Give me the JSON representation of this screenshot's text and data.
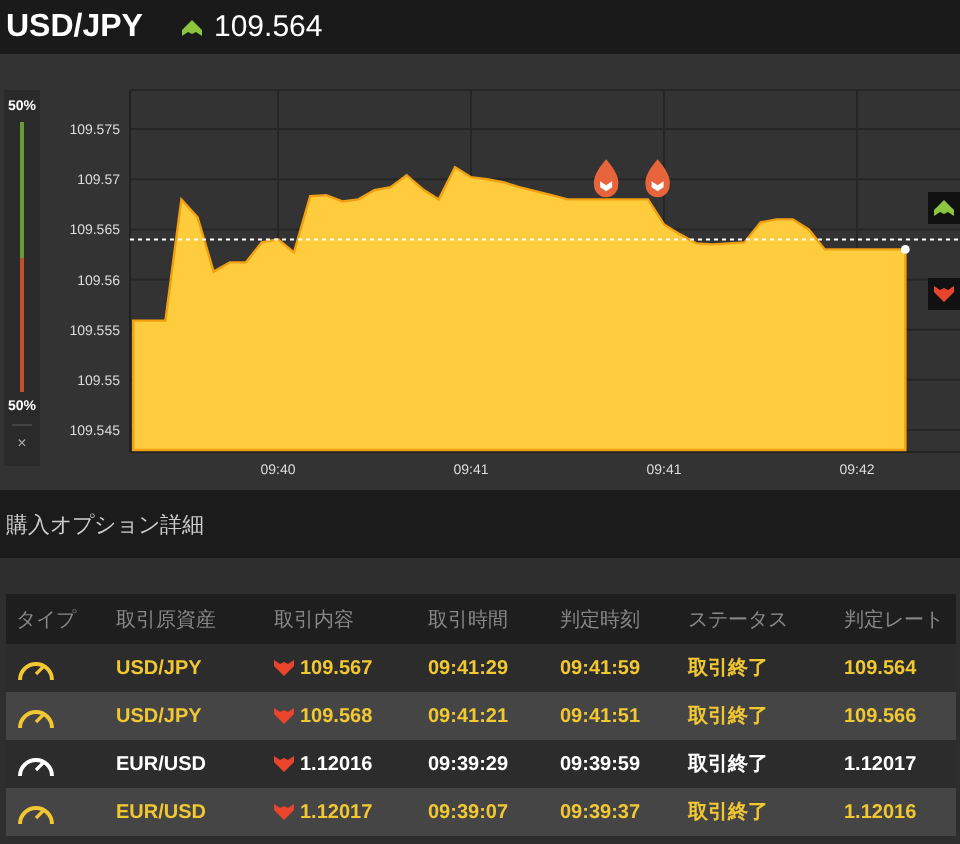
{
  "header": {
    "symbol": "USD/JPY",
    "kind": "up",
    "rate": "109.564"
  },
  "sentiment": {
    "top_label": "50%",
    "bottom_label": "50%",
    "level": 0.5,
    "close": "×"
  },
  "chart": {
    "chart_data": {
      "type": "area",
      "ylim": [
        109.543,
        109.5789
      ],
      "categories": [
        null,
        null,
        null,
        null,
        null,
        null,
        null,
        null,
        null,
        "09:40",
        null,
        null,
        null,
        null,
        null,
        null,
        null,
        null,
        null,
        null,
        null,
        "09:41",
        null,
        null,
        null,
        null,
        null,
        null,
        null,
        null,
        null,
        null,
        null,
        "09:41",
        null,
        null,
        null,
        null,
        null,
        null,
        null,
        null,
        null,
        null,
        null,
        "09:42",
        null,
        null,
        null
      ],
      "yticks": [
        109.545,
        109.55,
        109.555,
        109.56,
        109.565,
        109.57,
        109.575
      ],
      "series": [
        {
          "color": "#ffcc3d",
          "values": [
            109.5559,
            109.5559,
            109.5559,
            109.568,
            109.5662,
            109.5608,
            109.5617,
            109.5617,
            109.5637,
            109.564,
            109.5627,
            109.5683,
            109.5684,
            109.5678,
            109.568,
            109.5689,
            109.5692,
            109.5704,
            109.569,
            109.568,
            109.5712,
            109.5702,
            109.57,
            109.5697,
            109.5692,
            109.5688,
            109.5684,
            109.568,
            109.568,
            109.568,
            109.568,
            109.568,
            109.568,
            109.5655,
            109.5645,
            109.5636,
            109.5635,
            109.5636,
            109.5637,
            109.5657,
            109.566,
            109.566,
            109.565,
            109.563,
            109.563,
            109.563,
            109.563,
            109.563,
            109.563
          ]
        }
      ],
      "ref_lines": [
        {
          "axis": "y",
          "value": 109.564
        }
      ],
      "grid": true
    },
    "buttons": [
      {
        "kind": "up"
      },
      {
        "kind": "down"
      }
    ]
  },
  "section_title": "購入オプション詳細",
  "table": {
    "columns": [
      "タイプ",
      "取引原資産",
      "取引内容",
      "取引時間",
      "判定時刻",
      "ステータス",
      "判定レート"
    ],
    "rows": [
      {
        "asset": "USD/JPY",
        "kind": "down",
        "content": "109.567",
        "trade_time": "09:41:29",
        "judge_time": "09:41:59",
        "status": "取引終了",
        "rate": "109.564",
        "highlighted": true
      },
      {
        "asset": "USD/JPY",
        "kind": "down",
        "content": "109.568",
        "trade_time": "09:41:21",
        "judge_time": "09:41:51",
        "status": "取引終了",
        "rate": "109.566",
        "highlighted": true
      },
      {
        "asset": "EUR/USD",
        "kind": "down",
        "content": "1.12016",
        "trade_time": "09:39:29",
        "judge_time": "09:39:59",
        "status": "取引終了",
        "rate": "1.12017",
        "highlighted": false
      },
      {
        "asset": "EUR/USD",
        "kind": "down",
        "content": "1.12017",
        "trade_time": "09:39:07",
        "judge_time": "09:39:37",
        "status": "取引終了",
        "rate": "1.12016",
        "highlighted": true
      }
    ]
  }
}
